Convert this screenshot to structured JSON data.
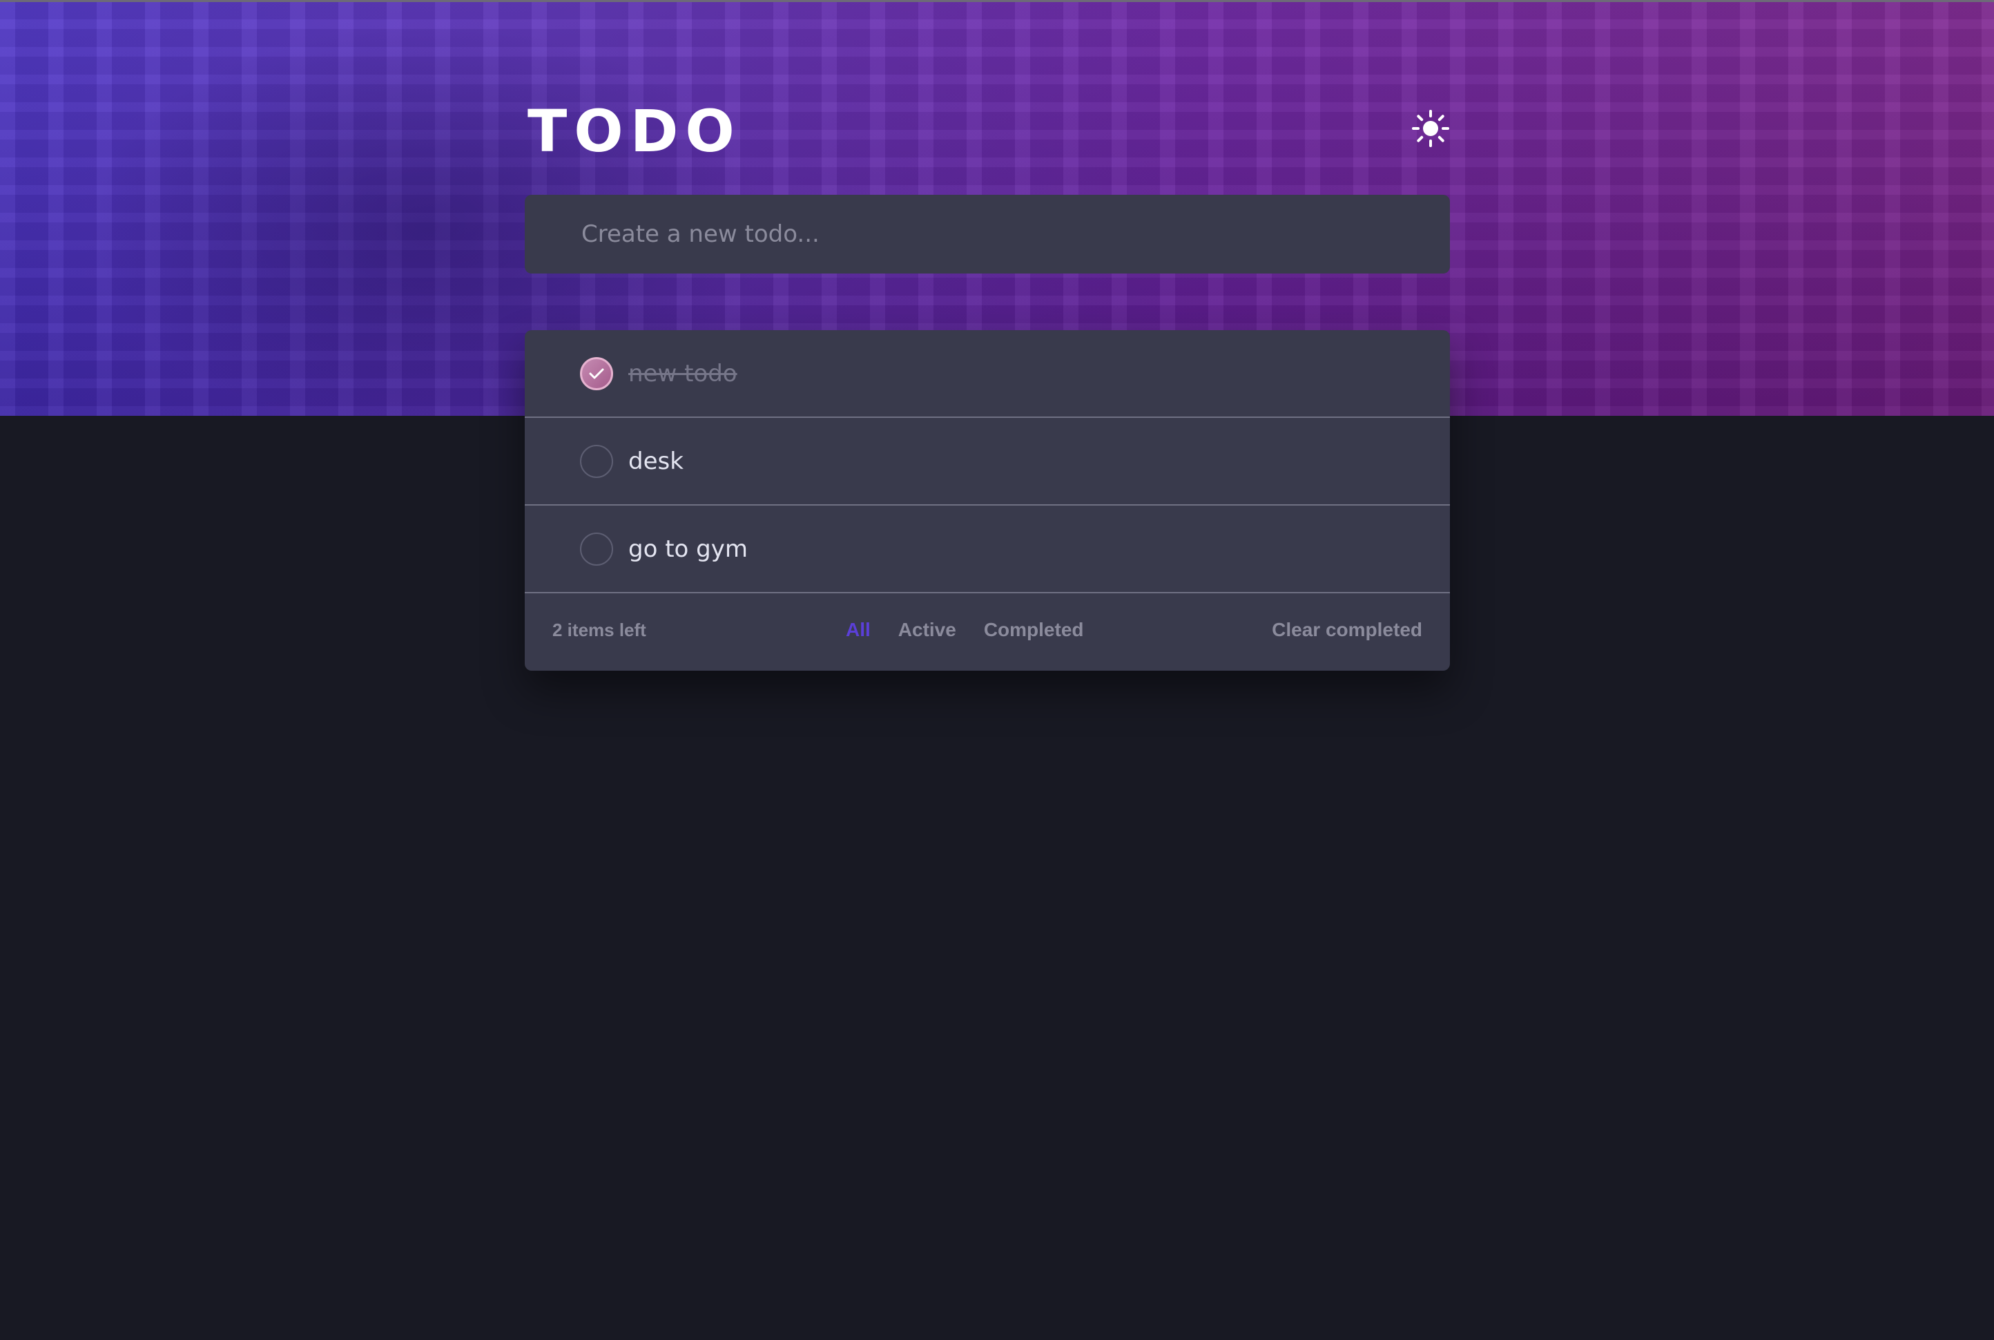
{
  "app": {
    "title": "TODO",
    "theme_icon": "sun-icon"
  },
  "new_todo": {
    "placeholder": "Create a new todo...",
    "value": ""
  },
  "todos": [
    {
      "text": "new todo",
      "completed": true
    },
    {
      "text": "desk",
      "completed": false
    },
    {
      "text": "go to gym",
      "completed": false
    }
  ],
  "footer": {
    "items_left": "2 items left",
    "filters": [
      {
        "label": "All",
        "active": true
      },
      {
        "label": "Active",
        "active": false
      },
      {
        "label": "Completed",
        "active": false
      }
    ],
    "clear_label": "Clear completed"
  },
  "colors": {
    "background": "#181923",
    "card": "#393a4c",
    "active_filter": "#5b3fd9",
    "check_gradient_start": "#c58bb2",
    "check_gradient_end": "#a55c8c"
  }
}
